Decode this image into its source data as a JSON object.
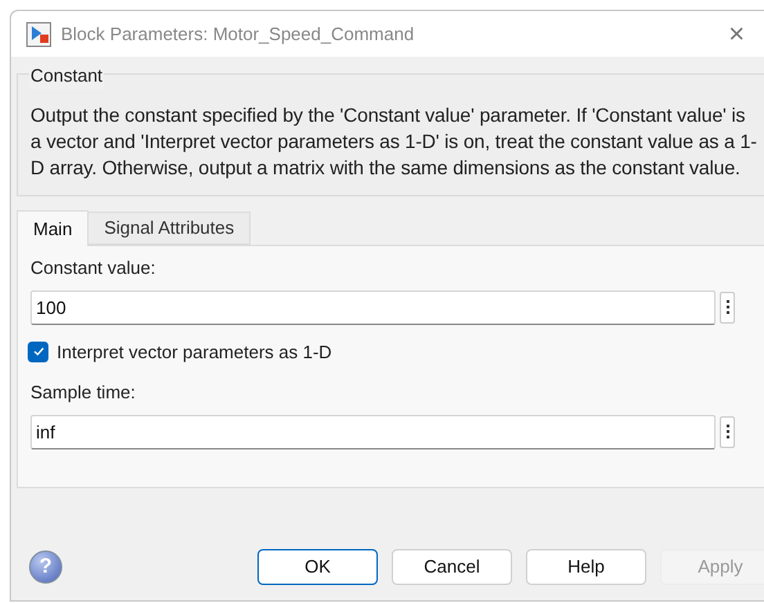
{
  "window": {
    "title": "Block Parameters: Motor_Speed_Command",
    "close": "×"
  },
  "block": {
    "name": "Constant",
    "description": "Output the constant specified by the 'Constant value' parameter. If 'Constant value' is a vector and 'Interpret vector parameters as 1-D' is on, treat the constant value as a 1-D array. Otherwise, output a matrix with the same dimensions as the constant value."
  },
  "tabs": [
    {
      "label": "Main",
      "selected": true
    },
    {
      "label": "Signal Attributes",
      "selected": false
    }
  ],
  "params": [
    {
      "kind": "field",
      "label": "Constant value:",
      "value": "100"
    },
    {
      "kind": "checkbox",
      "label": "Interpret vector parameters as 1-D",
      "checked": true
    },
    {
      "kind": "field",
      "label": "Sample time:",
      "value": "inf"
    }
  ],
  "help_icon": "?",
  "buttons": [
    {
      "label": "OK",
      "default": true,
      "disabled": false
    },
    {
      "label": "Cancel",
      "default": false,
      "disabled": false
    },
    {
      "label": "Help",
      "default": false,
      "disabled": false
    },
    {
      "label": "Apply",
      "default": false,
      "disabled": true
    }
  ]
}
